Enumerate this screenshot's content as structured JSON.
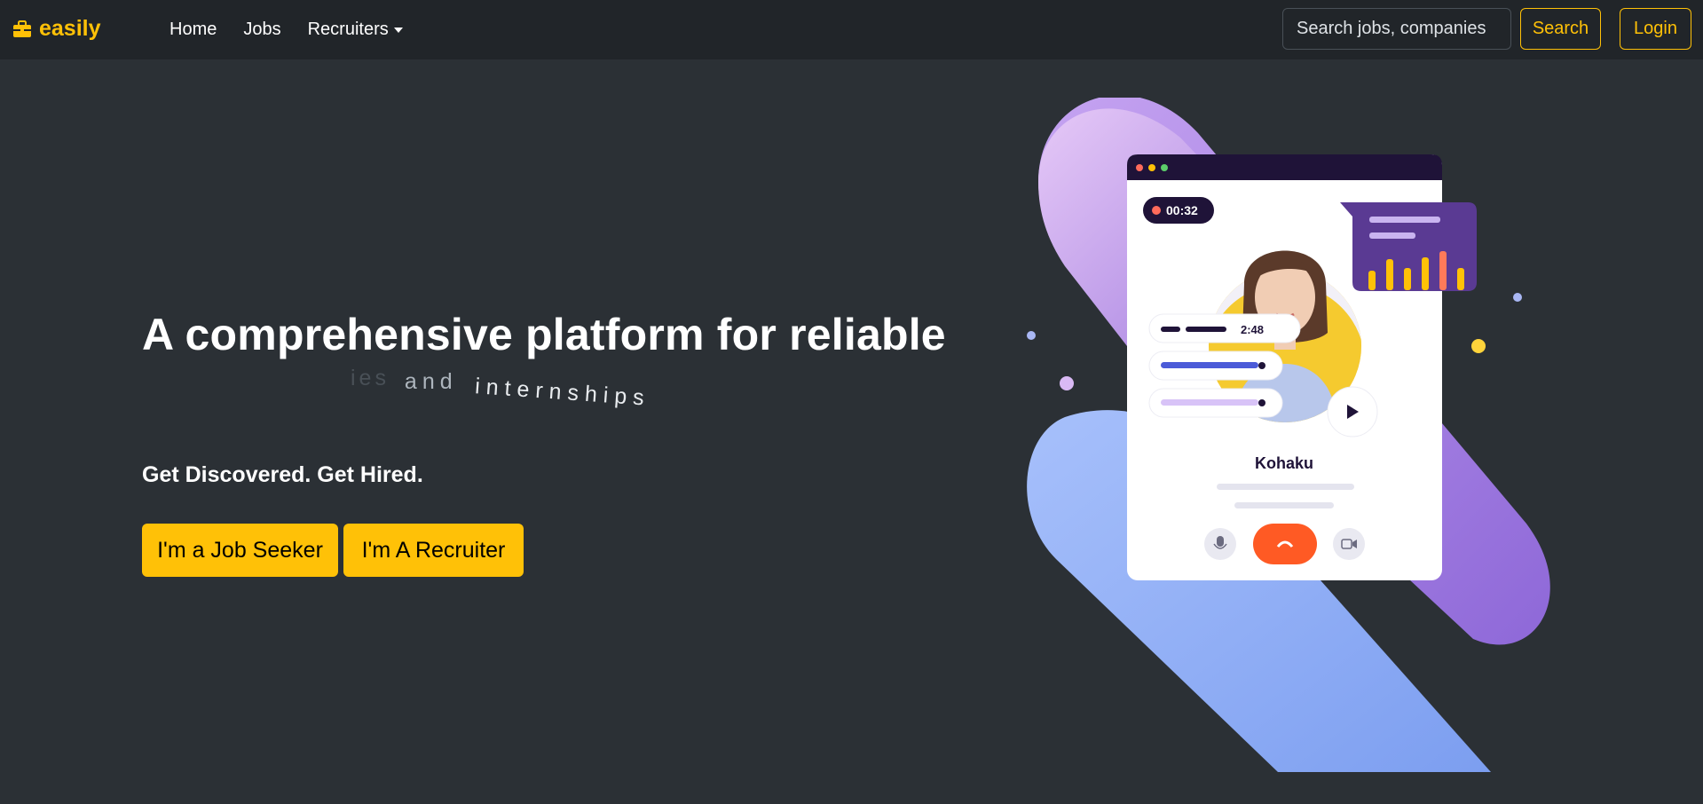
{
  "brand": {
    "name": "easily",
    "icon": "briefcase-icon",
    "color": "#ffc107"
  },
  "nav": {
    "links": [
      {
        "label": "Home"
      },
      {
        "label": "Jobs"
      },
      {
        "label": "Recruiters",
        "has_dropdown": true
      }
    ],
    "search_placeholder": "Search jobs, companies",
    "search_button": "Search",
    "login_button": "Login"
  },
  "hero": {
    "title": "A comprehensive platform for reliable",
    "animated_text": [
      "ies",
      "and",
      "internships"
    ],
    "tagline": "Get Discovered. Get Hired.",
    "buttons": {
      "job_seeker": "I'm a Job Seeker",
      "recruiter": "I'm A Recruiter"
    }
  },
  "illustration": {
    "timer": "00:32",
    "duration": "2:48",
    "name": "Kohaku"
  },
  "colors": {
    "accent": "#ffc107",
    "background": "#2b3035",
    "navbar": "#212529"
  }
}
